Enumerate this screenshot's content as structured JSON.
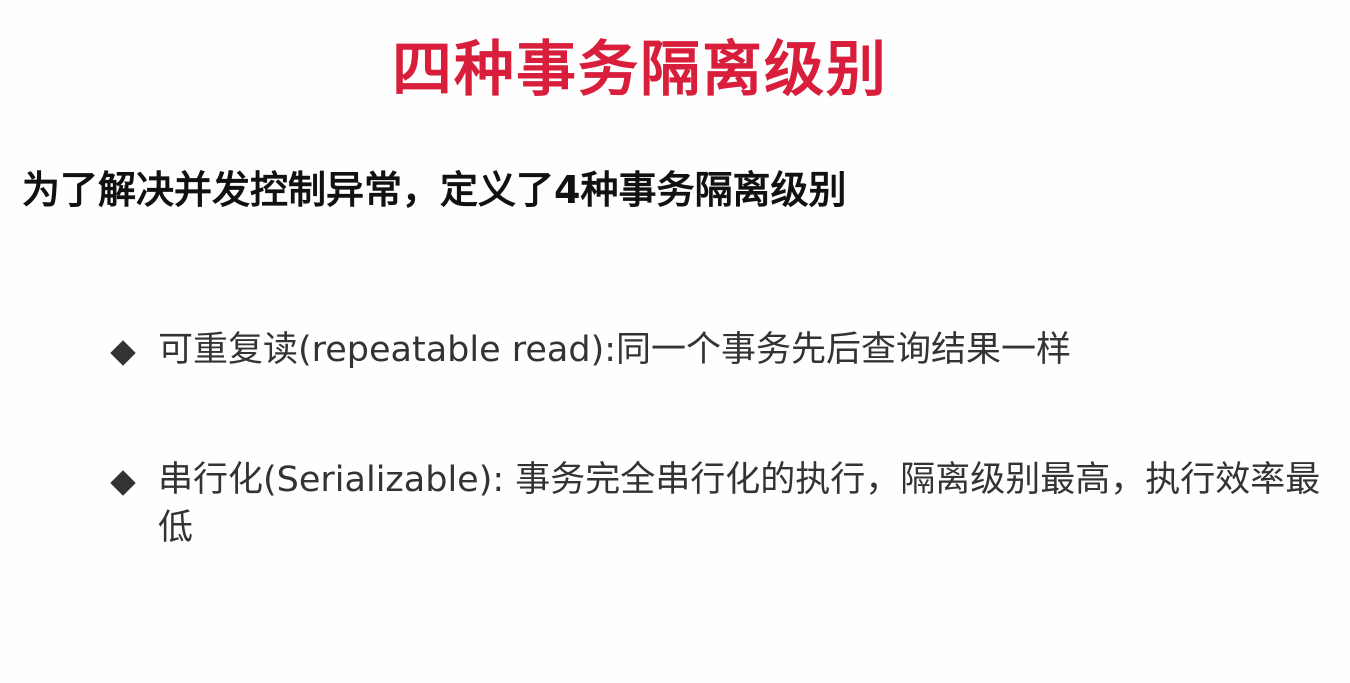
{
  "slide": {
    "title": "四种事务隔离级别",
    "subtitle": "为了解决并发控制异常，定义了4种事务隔离级别",
    "bullets": [
      {
        "text": "可重复读(repeatable read):同一个事务先后查询结果一样"
      },
      {
        "text": "串行化(Serializable): 事务完全串行化的执行，隔离级别最高，执行效率最低"
      }
    ]
  },
  "colors": {
    "title": "#d81e3a",
    "subtitle": "#111111",
    "body": "#333333",
    "background": "#ffffff"
  }
}
